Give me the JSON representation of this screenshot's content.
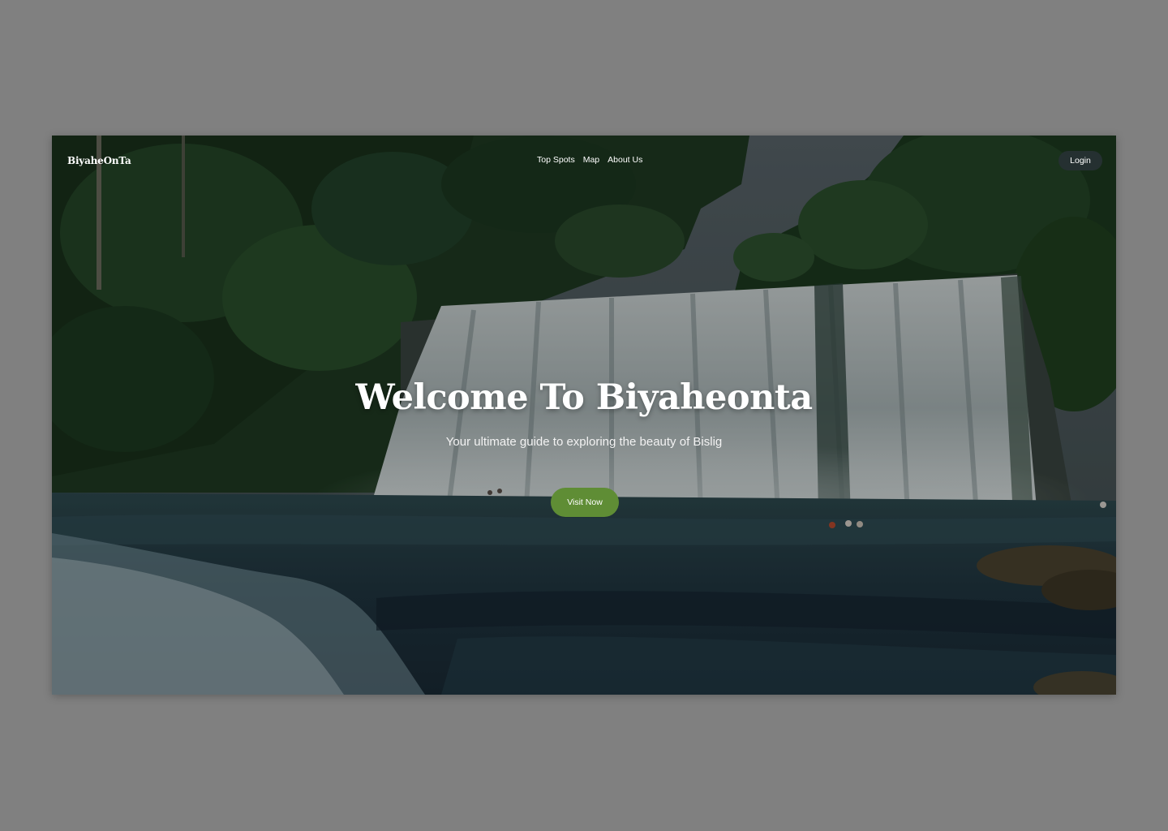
{
  "header": {
    "brand": "BiyaheOnTa",
    "nav": [
      {
        "label": "Top Spots"
      },
      {
        "label": "Map"
      },
      {
        "label": "About Us"
      }
    ],
    "login_label": "Login"
  },
  "hero": {
    "title": "Welcome To Biyaheonta",
    "subtitle": "Your ultimate guide to exploring the beauty of Bislig",
    "cta_label": "Visit Now",
    "background_image": "waterfall-in-forest"
  },
  "colors": {
    "page_backdrop": "#808080",
    "login_button": "#253031",
    "cta_button": "#5f8d35",
    "text": "#ffffff"
  }
}
